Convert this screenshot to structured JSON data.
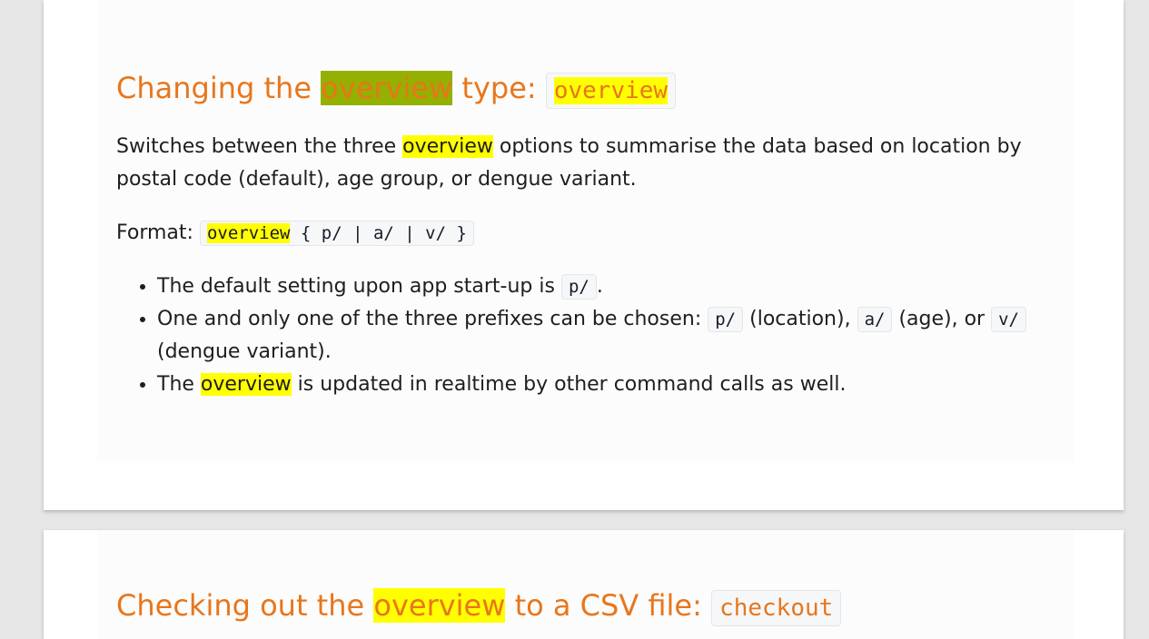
{
  "section1": {
    "heading_prefix": "Changing the ",
    "heading_highlight": "overview",
    "heading_suffix": " type: ",
    "heading_code": "overview",
    "desc_before": "Switches between the three ",
    "desc_highlight": "overview",
    "desc_after": " options to summarise the data based on location by postal code (default), age group, or dengue variant.",
    "format_label": "Format: ",
    "format_highlight": "overview",
    "format_rest": " { p/ | a/ | v/ }",
    "bullets": [
      {
        "text1": "The default setting upon app start-up is ",
        "code1": "p/",
        "text2": "."
      },
      {
        "text1": "One and only one of the three prefixes can be chosen: ",
        "code1": "p/",
        "text2": " (location), ",
        "code2": "a/",
        "text3": " (age), or ",
        "code3": "v/",
        "text4": " (dengue variant)."
      },
      {
        "text1": "The ",
        "highlight": "overview",
        "text2": " is updated in realtime by other command calls as well."
      }
    ]
  },
  "section2": {
    "heading_prefix": "Checking out the ",
    "heading_highlight": "overview",
    "heading_suffix": " to a CSV file: ",
    "heading_code": "checkout"
  },
  "colors": {
    "heading": "#e8761c",
    "search_highlight": "#ffff00",
    "active_highlight": "#94b000"
  }
}
